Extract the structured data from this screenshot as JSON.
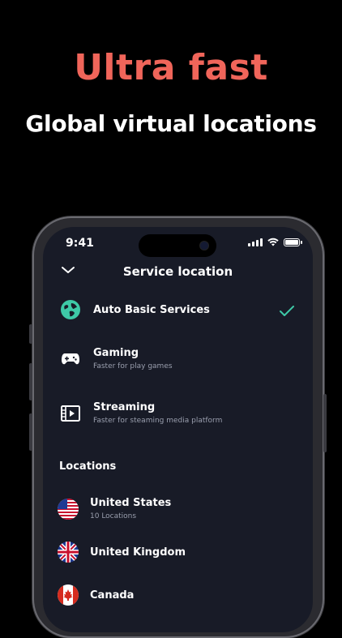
{
  "headline": "Ultra fast",
  "subhead": "Global virtual locations",
  "status": {
    "time": "9:41"
  },
  "nav": {
    "title": "Service location"
  },
  "services": [
    {
      "name": "Auto Basic Services",
      "desc": "",
      "icon": "globe-icon",
      "selected": true
    },
    {
      "name": "Gaming",
      "desc": "Faster for play games",
      "icon": "gamepad-icon",
      "selected": false
    },
    {
      "name": "Streaming",
      "desc": "Faster for steaming media platform",
      "icon": "video-icon",
      "selected": false
    }
  ],
  "locations_header": "Locations",
  "locations": [
    {
      "name": "United States",
      "desc": "10 Locations",
      "icon": "us-flag-icon"
    },
    {
      "name": "United Kingdom",
      "desc": "",
      "icon": "uk-flag-icon"
    },
    {
      "name": "Canada",
      "desc": "",
      "icon": "canada-flag-icon"
    }
  ],
  "colors": {
    "accent": "#f0655a",
    "check": "#3ec9a7",
    "screen_bg": "#181b27"
  }
}
